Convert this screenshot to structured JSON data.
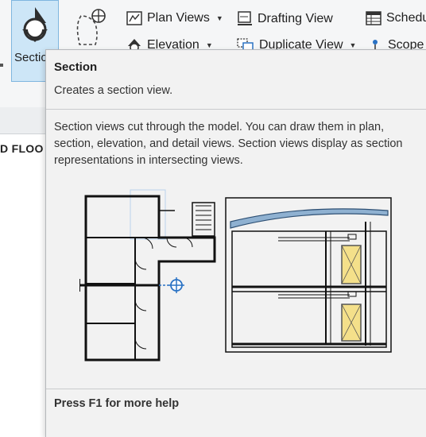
{
  "ribbon": {
    "section_button": {
      "label": "Section",
      "icon": "section-marker-icon"
    },
    "callout_icon": "callout-icon",
    "plan_views": {
      "label": "Plan Views",
      "icon": "plan-views-icon"
    },
    "drafting_view": {
      "label": "Drafting View",
      "icon": "drafting-view-icon"
    },
    "schedules": {
      "label": "Schedu",
      "icon": "schedules-icon"
    },
    "elevation": {
      "label": "Elevation",
      "icon": "elevation-icon"
    },
    "duplicate_view": {
      "label": "Duplicate View",
      "icon": "duplicate-view-icon"
    },
    "scope_box": {
      "label": "Scope",
      "icon": "scope-box-icon"
    }
  },
  "view": {
    "title": "D FLOO"
  },
  "tooltip": {
    "title": "Section",
    "subtitle": "Creates a section view.",
    "description": "Section views cut through the model. You can draw them in plan, section, elevation, and detail views. Section views display as section representations in intersecting views.",
    "footer": "Press F1 for more help"
  },
  "colors": {
    "accent_selected": "#cde6f7",
    "door_fill": "#f4e08a",
    "roof_fill": "#8fb1d1",
    "section_mark": "#2a72c4"
  }
}
